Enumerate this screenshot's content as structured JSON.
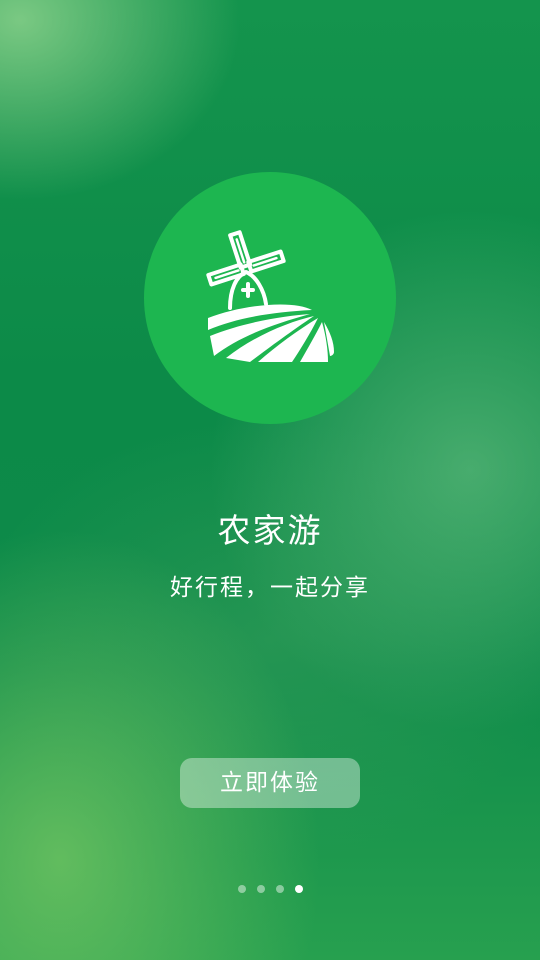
{
  "app": {
    "title": "农家游",
    "subtitle": "好行程，一起分享"
  },
  "logo": {
    "icon": "windmill-farm-icon",
    "circle_color": "#1db650"
  },
  "start_button": {
    "label": "立即体验"
  },
  "pager": {
    "total": 4,
    "active_index": 3
  },
  "colors": {
    "background": "#0a8a49",
    "text": "#ffffff"
  }
}
